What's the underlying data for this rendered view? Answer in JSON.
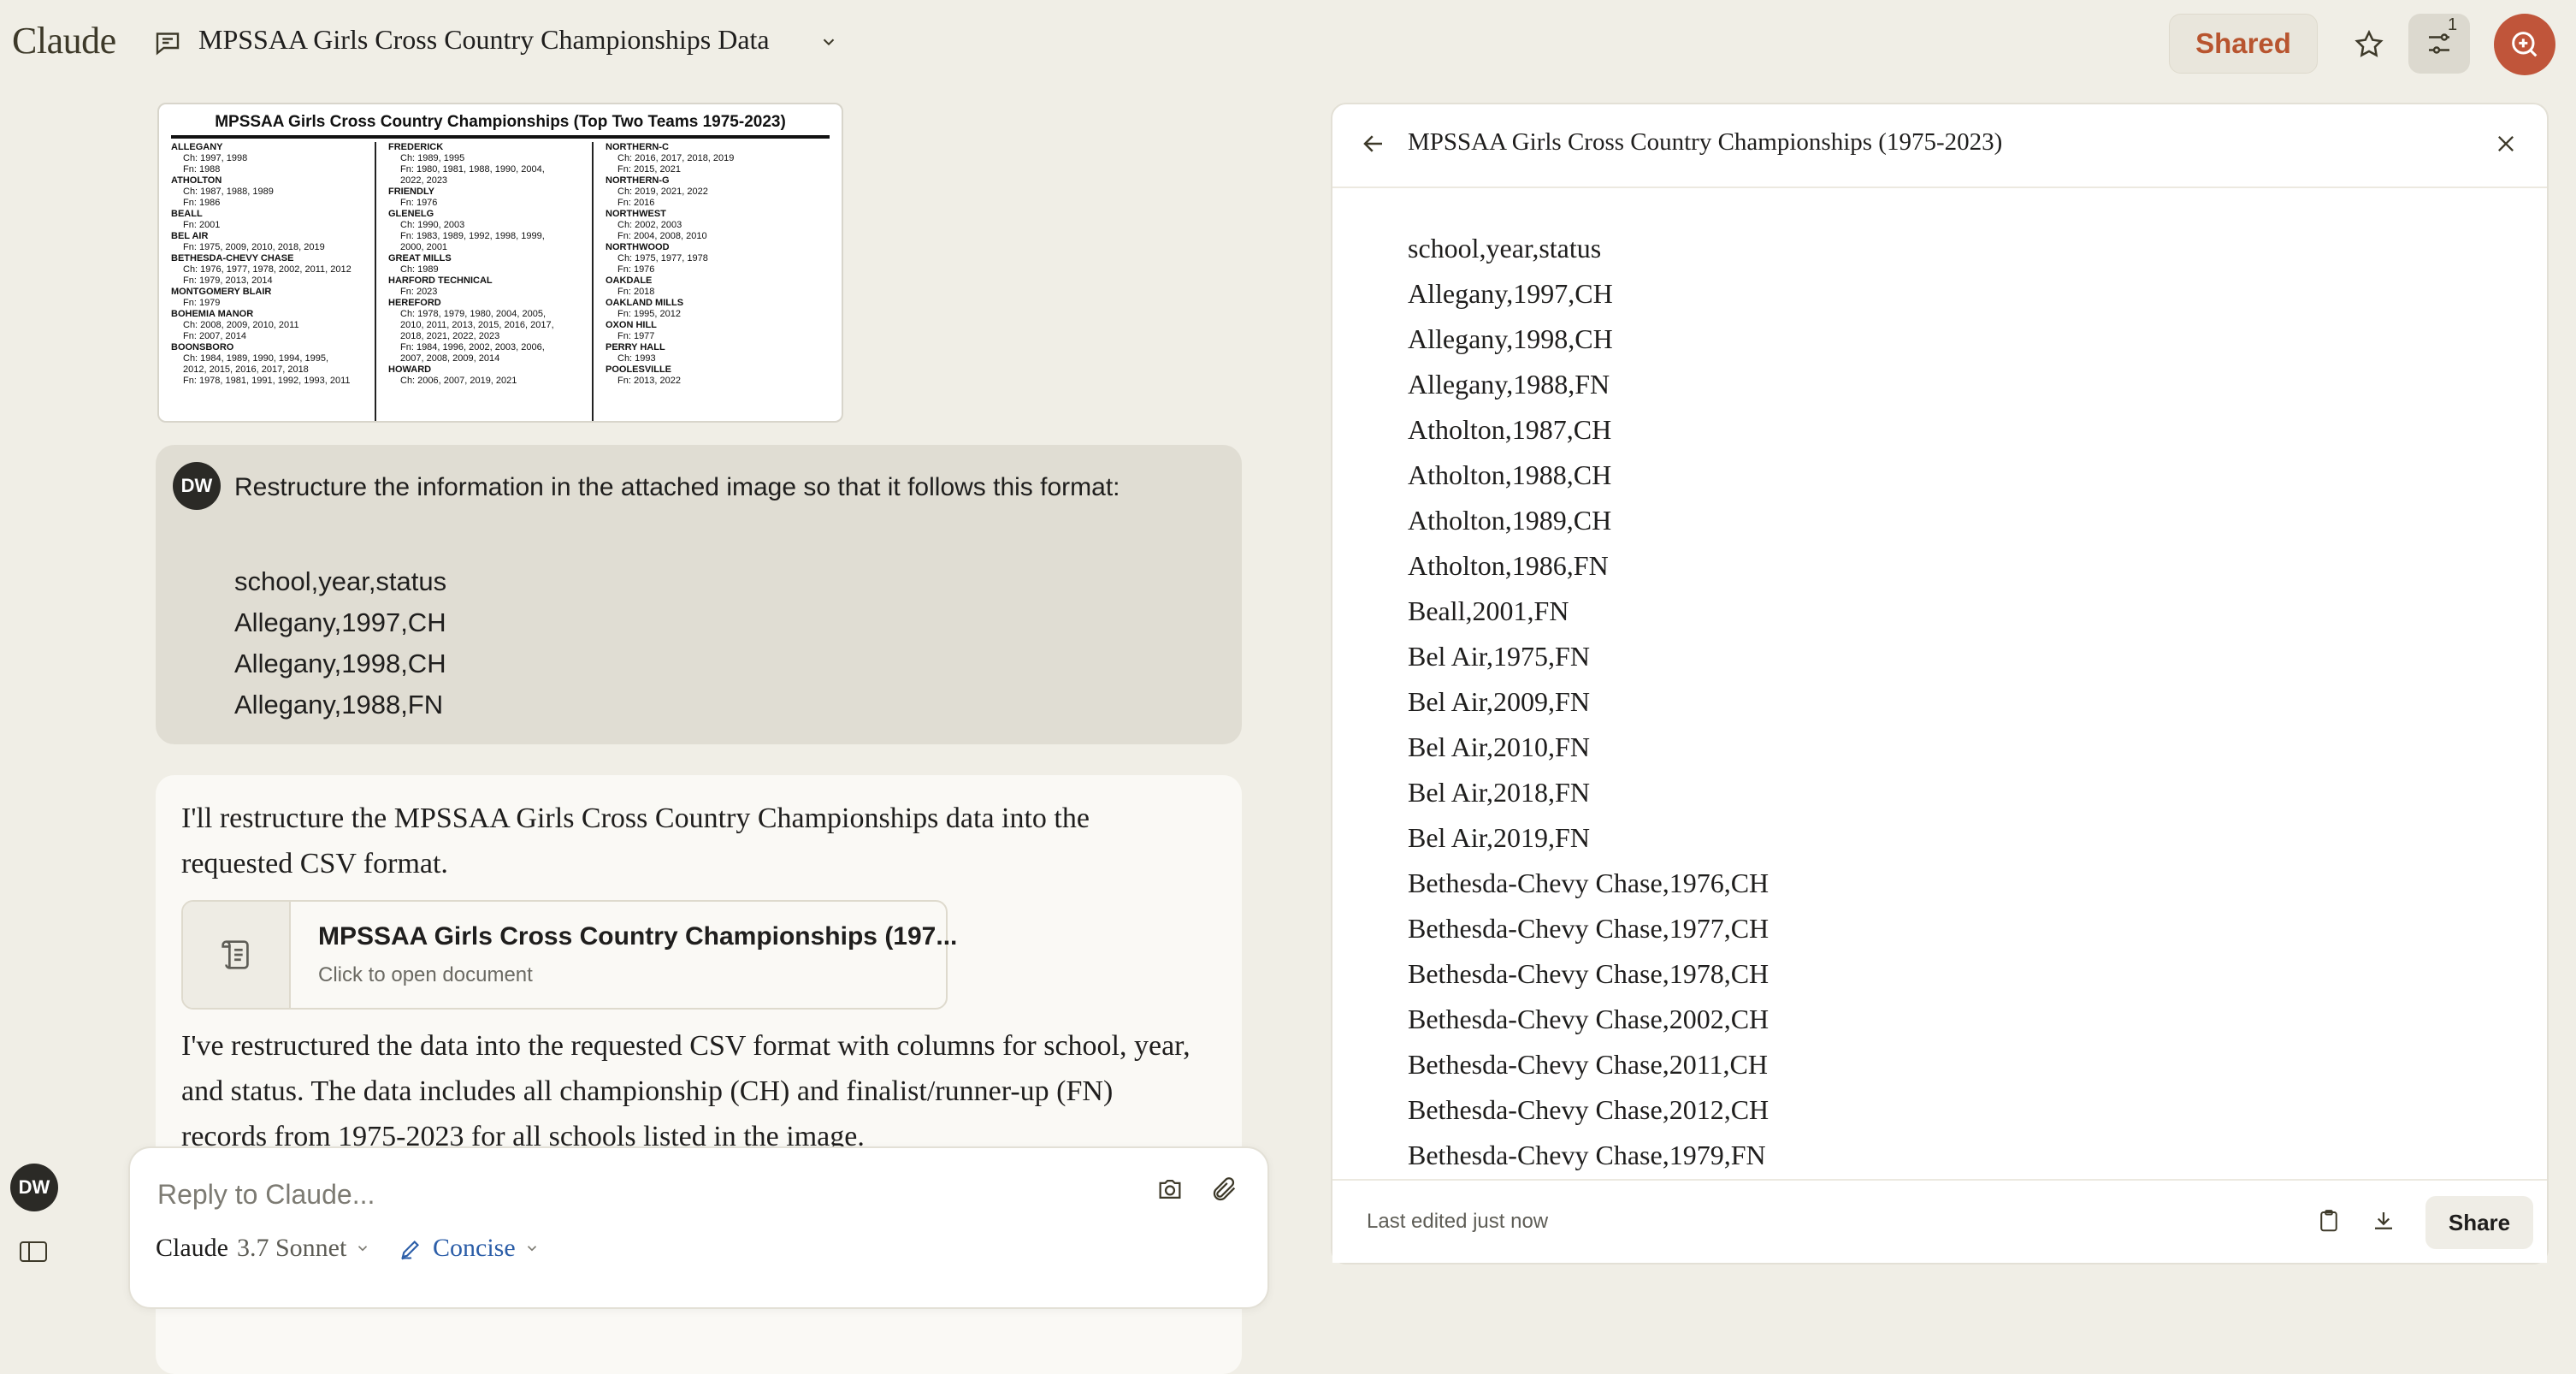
{
  "app": {
    "logo": "Claude"
  },
  "header": {
    "conversation_title": "MPSSAA Girls Cross Country Championships Data",
    "shared_label": "Shared",
    "filter_badge": "1"
  },
  "user_avatar_initials": "DW",
  "attachment": {
    "title": "MPSSAA Girls Cross Country Championships (Top Two Teams 1975-2023)",
    "columns": [
      [
        {
          "school": "ALLEGANY",
          "rows": [
            "Ch: 1997, 1998",
            "Fn: 1988"
          ]
        },
        {
          "school": "ATHOLTON",
          "rows": [
            "Ch: 1987, 1988, 1989",
            "Fn: 1986"
          ]
        },
        {
          "school": "BEALL",
          "rows": [
            "Fn: 2001"
          ]
        },
        {
          "school": "BEL AIR",
          "rows": [
            "Fn: 1975, 2009, 2010, 2018, 2019"
          ]
        },
        {
          "school": "BETHESDA-CHEVY CHASE",
          "rows": [
            "Ch: 1976, 1977, 1978, 2002, 2011, 2012",
            "Fn: 1979, 2013, 2014"
          ]
        },
        {
          "school": "MONTGOMERY BLAIR",
          "rows": [
            "Fn: 1979"
          ]
        },
        {
          "school": "BOHEMIA MANOR",
          "rows": [
            "Ch: 2008, 2009, 2010, 2011",
            "Fn: 2007, 2014"
          ]
        },
        {
          "school": "BOONSBORO",
          "rows": [
            "Ch: 1984, 1989, 1990, 1994, 1995,",
            "2012, 2015, 2016, 2017, 2018",
            "Fn: 1978, 1981, 1991, 1992, 1993, 2011"
          ]
        }
      ],
      [
        {
          "school": "FREDERICK",
          "rows": [
            "Ch: 1989, 1995",
            "Fn: 1980, 1981, 1988, 1990, 2004,",
            "2022, 2023"
          ]
        },
        {
          "school": "FRIENDLY",
          "rows": [
            "Fn: 1976"
          ]
        },
        {
          "school": "GLENELG",
          "rows": [
            "Ch: 1990, 2003",
            "Fn: 1983, 1989, 1992, 1998, 1999,",
            "2000, 2001"
          ]
        },
        {
          "school": "GREAT MILLS",
          "rows": [
            "Ch: 1989"
          ]
        },
        {
          "school": "HARFORD TECHNICAL",
          "rows": [
            "Fn: 2023"
          ]
        },
        {
          "school": "HEREFORD",
          "rows": [
            "Ch: 1978, 1979, 1980, 2004, 2005,",
            "2010, 2011, 2013, 2015, 2016, 2017,",
            "2018, 2021, 2022, 2023",
            "Fn: 1984, 1996, 2002, 2003, 2006,",
            "2007, 2008, 2009, 2014"
          ]
        },
        {
          "school": "HOWARD",
          "rows": [
            "Ch: 2006, 2007, 2019, 2021"
          ]
        }
      ],
      [
        {
          "school": "NORTHERN-C",
          "rows": [
            "Ch: 2016, 2017, 2018, 2019",
            "Fn: 2015, 2021"
          ]
        },
        {
          "school": "NORTHERN-G",
          "rows": [
            "Ch: 2019, 2021, 2022",
            "Fn: 2016"
          ]
        },
        {
          "school": "NORTHWEST",
          "rows": [
            "Ch: 2002, 2003",
            "Fn: 2004, 2008, 2010"
          ]
        },
        {
          "school": "NORTHWOOD",
          "rows": [
            "Ch: 1975, 1977, 1978",
            "Fn: 1976"
          ]
        },
        {
          "school": "OAKDALE",
          "rows": [
            "Fn: 2018"
          ]
        },
        {
          "school": "OAKLAND MILLS",
          "rows": [
            "Fn: 1995, 2012"
          ]
        },
        {
          "school": "OXON HILL",
          "rows": [
            "Fn: 1977"
          ]
        },
        {
          "school": "PERRY HALL",
          "rows": [
            "Ch: 1993"
          ]
        },
        {
          "school": "POOLESVILLE",
          "rows": [
            "Fn: 2013, 2022"
          ]
        }
      ]
    ]
  },
  "user_message": {
    "text": "Restructure the information in the attached image so that it follows this format:",
    "lines": [
      "school,year,status",
      "Allegany,1997,CH",
      "Allegany,1998,CH",
      "Allegany,1988,FN"
    ]
  },
  "assistant": {
    "intro": "I'll restructure the MPSSAA Girls Cross Country Championships data into the requested CSV format.",
    "artifact_title": "MPSSAA Girls Cross Country Championships (197...",
    "artifact_sub": "Click to open document",
    "outro": "I've restructured the data into the requested CSV format with columns for school, year, and status. The data includes all championship (CH) and finalist/runner-up (FN) records from 1975-2023 for all schools listed in the image."
  },
  "composer": {
    "placeholder": "Reply to Claude...",
    "model_name": "Claude",
    "model_version": "3.7 Sonnet",
    "style": "Concise"
  },
  "panel": {
    "title": "MPSSAA Girls Cross Country Championships (1975-2023)",
    "lines": [
      "school,year,status",
      "Allegany,1997,CH",
      "Allegany,1998,CH",
      "Allegany,1988,FN",
      "Atholton,1987,CH",
      "Atholton,1988,CH",
      "Atholton,1989,CH",
      "Atholton,1986,FN",
      "Beall,2001,FN",
      "Bel Air,1975,FN",
      "Bel Air,2009,FN",
      "Bel Air,2010,FN",
      "Bel Air,2018,FN",
      "Bel Air,2019,FN",
      "Bethesda-Chevy Chase,1976,CH",
      "Bethesda-Chevy Chase,1977,CH",
      "Bethesda-Chevy Chase,1978,CH",
      "Bethesda-Chevy Chase,2002,CH",
      "Bethesda-Chevy Chase,2011,CH",
      "Bethesda-Chevy Chase,2012,CH",
      "Bethesda-Chevy Chase,1979,FN"
    ],
    "footer_status": "Last edited just now",
    "share_label": "Share"
  },
  "colors": {
    "accent": "#c0553a",
    "shared_text": "#b8552f",
    "style_blue": "#2c5ea8",
    "background": "#f0eee6"
  }
}
